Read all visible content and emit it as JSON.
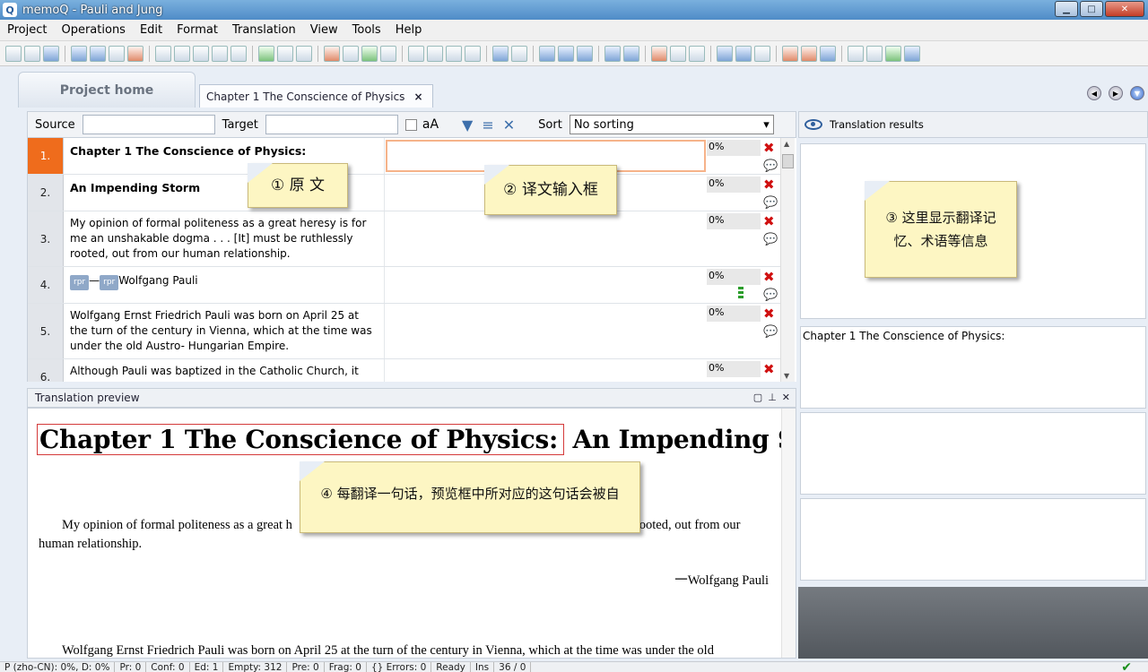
{
  "window": {
    "title": "memoQ - Pauli and Jung",
    "app_icon_letter": "Q"
  },
  "menu": [
    "Project",
    "Operations",
    "Edit",
    "Format",
    "Translation",
    "View",
    "Tools",
    "Help"
  ],
  "tabs": {
    "home": "Project home",
    "document": "Chapter 1 The Conscience of Physics",
    "close": "×"
  },
  "filter": {
    "source_label": "Source",
    "target_label": "Target",
    "case_label": "aA",
    "sort_label": "Sort",
    "sort_value": "No sorting"
  },
  "rows": [
    {
      "num": "1.",
      "source": "Chapter 1 The Conscience of Physics:",
      "status": "0%"
    },
    {
      "num": "2.",
      "source": "An Impending Storm",
      "status": "0%"
    },
    {
      "num": "3.",
      "source": "My opinion of formal politeness as a great heresy is for me an unshakable dogma . . . [It] must be ruthlessly rooted, out from our human relationship.",
      "status": "0%"
    },
    {
      "num": "4.",
      "tag1": "rpr",
      "dash": "—",
      "tag2": "rpr",
      "source": "Wolfgang Pauli",
      "status": "0%"
    },
    {
      "num": "5.",
      "source": "Wolfgang Ernst Friedrich Pauli was born on April 25 at the turn of the century in Vienna, which at the time was under the old Austro- Hungarian Empire.",
      "status": "0%"
    },
    {
      "num": "6.",
      "source": "Although Pauli was baptized in the Catholic Church, it was",
      "status": "0%"
    }
  ],
  "preview": {
    "title": "Translation preview",
    "heading_hl": "Chapter 1 The Conscience of Physics:",
    "heading_rest": "An Impending Storm",
    "para1_start": "My opinion of formal politeness as a great h",
    "para1_end": "rooted, out from our",
    "para1_line2": "human relationship.",
    "signature": "一Wolfgang Pauli",
    "para2": "Wolfgang Ernst Friedrich Pauli was born on April 25 at the turn of the century in Vienna, which at the time was under the old"
  },
  "right_pane": {
    "title": "Translation results",
    "source_echo": "Chapter 1 The Conscience of Physics:"
  },
  "notes": {
    "source": "① 原 文",
    "target": "② 译文输入框",
    "results_l1": "③ 这里显示翻译记",
    "results_l2": "忆、术语等信息",
    "preview": "④ 每翻译一句话，预览框中所对应的这句话会被自"
  },
  "status_bar": [
    "P (zho-CN): 0%, D: 0%",
    "Pr: 0",
    "Conf: 0",
    "Ed: 1",
    "Empty: 312",
    "Pre: 0",
    "Frag: 0",
    "{} Errors: 0",
    "Ready",
    "Ins",
    "36 / 0"
  ],
  "colors": {
    "active_row": "#ef6c1c",
    "note_bg": "#fdf6c3",
    "error_x": "#d01010"
  }
}
